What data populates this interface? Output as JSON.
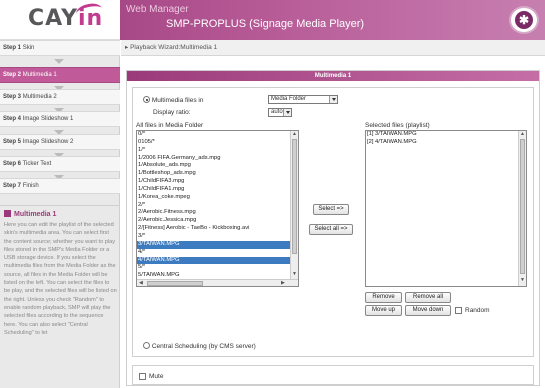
{
  "header": {
    "logo_prefix": "CA",
    "logo_mid": "Y",
    "logo_suffix": "in",
    "app_title": "Web Manager",
    "app_subtitle": "SMP-PROPLUS (Signage Media Player)"
  },
  "sidebar": {
    "steps": [
      {
        "num": "Step 1",
        "label": "Skin"
      },
      {
        "num": "Step 2",
        "label": "Multimedia 1"
      },
      {
        "num": "Step 3",
        "label": "Multimedia 2"
      },
      {
        "num": "Step 4",
        "label": "Image Slideshow 1"
      },
      {
        "num": "Step 5",
        "label": "Image Slideshow 2"
      },
      {
        "num": "Step 6",
        "label": "Ticker Text"
      },
      {
        "num": "Step 7",
        "label": "Finish"
      }
    ],
    "help_title": "Multimedia 1",
    "help_text": "Here you can edit the playlist of the selected skin's multimedia area. You can select first the content source; whether you want to play files stored in the SMP's Media Folder or a USB storage device. If you select the multimedia files from the Media Folder as the source, all files in the Media Folder will be listed on the left. You can select the files to be play, and the selected files will be listed on the right. Unless you check \"Random\" to enable random playback, SMP will play the selected files according to the sequence here. You can also select \"Central Scheduling\" to let"
  },
  "breadcrumb": "Playback Wizard:Multimedia 1",
  "panel": {
    "title": "Multimedia 1",
    "source_label": "Multimedia files in",
    "source_value": "Media Folder",
    "ratio_label": "Display ratio:",
    "ratio_value": "auto",
    "all_files_label": "All files in Media Folder",
    "selected_label": "Selected files (playlist)",
    "all_files": [
      "0/*",
      "0105/*",
      "1/*",
      "1/2006 FIFA.Germany_ads.mpg",
      "1/Absolute_ads.mpg",
      "1/Bottleshop_ads.mpg",
      "1/ChildFIFA3.mpg",
      "1/ChildFIFA1.mpg",
      "1/Korea_coke.mpeg",
      "2/*",
      "2/Aerobic.Fitness.mpg",
      "2/Aerobic.Jessica.mpg",
      "2/[Fitness] Aerobic - TaeBo - Kickboxing.avi",
      "3/*",
      "3/TAIWAN.MPG",
      "4/*",
      "4/TAIWAN.MPG",
      "5/*",
      "5/TAIWAN.MPG"
    ],
    "selected_indices": [
      14,
      16
    ],
    "playlist": [
      "[1] 3/TAIWAN.MPG",
      "[2] 4/TAIWAN.MPG"
    ],
    "select_btn": "Select =>",
    "select_all_btn": "Select all =>",
    "remove_btn": "Remove",
    "remove_all_btn": "Remove all",
    "move_up_btn": "Move up",
    "move_down_btn": "Move down",
    "random_label": "Random",
    "central_label": "Central Scheduling (by CMS server)",
    "mute_label": "Mute"
  },
  "colors": {
    "brand": "#9b3a7a",
    "active_step": "#c05a99",
    "selection": "#3d7bc1"
  }
}
